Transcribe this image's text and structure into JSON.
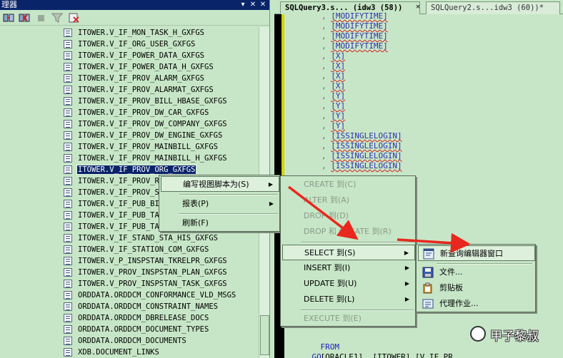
{
  "explorer": {
    "title": "理器",
    "pin_glyph": "▾",
    "autohide_glyph": "✕",
    "close_glyph": "✕",
    "tree_items": [
      "ITOWER.V_IF_MON_TASK_H_GXFGS",
      "ITOWER.V_IF_ORG_USER_GXFGS",
      "ITOWER.V_IF_POWER_DATA_GXFGS",
      "ITOWER.V_IF_POWER_DATA_H_GXFGS",
      "ITOWER.V_IF_PROV_ALARM_GXFGS",
      "ITOWER.V_IF_PROV_ALARMAT_GXFGS",
      "ITOWER.V_IF_PROV_BILL_HBASE_GXFGS",
      "ITOWER.V_IF_PROV_DW_CAR_GXFGS",
      "ITOWER.V_IF_PROV_DW_COMPANY_GXFGS",
      "ITOWER.V_IF_PROV_DW_ENGINE_GXFGS",
      "ITOWER.V_IF_PROV_MAINBILL_GXFGS",
      "ITOWER.V_IF_PROV_MAINBILL_H_GXFGS",
      "ITOWER.V_IF_PROV_ORG_GXFGS",
      "ITOWER.V_IF_PROV_RO",
      "ITOWER.V_IF_PROV_ST",
      "ITOWER.V_IF_PUB_BI",
      "ITOWER.V_IF_PUB_TAS",
      "ITOWER.V_IF_PUB_TAS",
      "ITOWER.V_IF_STAND_STA_HIS_GXFGS",
      "ITOWER.V_IF_STATION_COM_GXFGS",
      "ITOWER.V_P_INSPSTAN_TKRELPR_GXFGS",
      "ITOWER.V_PROV_INSPSTAN_PLAN_GXFGS",
      "ITOWER.V_PROV_INSPSTAN_TASK_GXFGS",
      "ORDDATA.ORDDCM_CONFORMANCE_VLD_MSGS",
      "ORDDATA.ORDDCM_CONSTRAINT_NAMES",
      "ORDDATA.ORDDCM_DBRELEASE_DOCS",
      "ORDDATA.ORDDCM_DOCUMENT_TYPES",
      "ORDDATA.ORDDCM_DOCUMENTS",
      "XDB.DOCUMENT_LINKS"
    ],
    "selected_index": 12
  },
  "tabs": [
    {
      "label": "SQLQuery3.s... (idw3 (58))",
      "close": "✕"
    },
    {
      "label": "SQLQuery2.s...idw3 (60))*"
    }
  ],
  "code": {
    "lines": [
      ", [MODIFYTIME]",
      ", [MODIFYTIME]",
      ", [MODIFYTIME]",
      ", [MODIFYTIME]",
      ", [X]",
      ", [X]",
      ", [X]",
      ", [X]",
      ", [Y]",
      ", [Y]",
      ", [Y]",
      ", [Y]",
      ", [ISSINGLELOGIN]",
      ", [ISSINGLELOGIN]",
      ", [ISSINGLELOGIN]",
      ", [ISSINGLELOGIN]"
    ],
    "from_kw": "FROM",
    "from_obj": "[ORACLE1]..[ITOWER].[V_IF_PR",
    "go_kw": "GO"
  },
  "context_menu_1": {
    "items": [
      {
        "label": "编写视图脚本为(S)",
        "submenu": true
      },
      {
        "label": "报表(P)",
        "submenu": true
      },
      {
        "label": "刷新(F)",
        "submenu": false
      }
    ]
  },
  "context_menu_2": {
    "items": [
      {
        "label": "CREATE 到(C)",
        "submenu": false
      },
      {
        "label": "ALTER 到(A)",
        "submenu": false
      },
      {
        "label": "DROP 到(D)",
        "submenu": false
      },
      {
        "label": "DROP 和 CREATE 到(R)",
        "submenu": false
      },
      {
        "label": "SELECT 到(S)",
        "submenu": true
      },
      {
        "label": "INSERT 到(I)",
        "submenu": true
      },
      {
        "label": "UPDATE 到(U)",
        "submenu": true
      },
      {
        "label": "DELETE 到(L)",
        "submenu": true
      },
      {
        "label": "EXECUTE 到(E)",
        "submenu": false
      }
    ]
  },
  "context_menu_3": {
    "items": [
      {
        "label": "新查询编辑器窗口"
      },
      {
        "label": "文件..."
      },
      {
        "label": "剪贴板"
      },
      {
        "label": "代理作业..."
      }
    ]
  },
  "watermark": {
    "text": "甲子黎叔"
  },
  "colors": {
    "selection": "#0a246a",
    "annotation_arrow": "#e8281e",
    "editor_bg": "#c7e6c7"
  }
}
